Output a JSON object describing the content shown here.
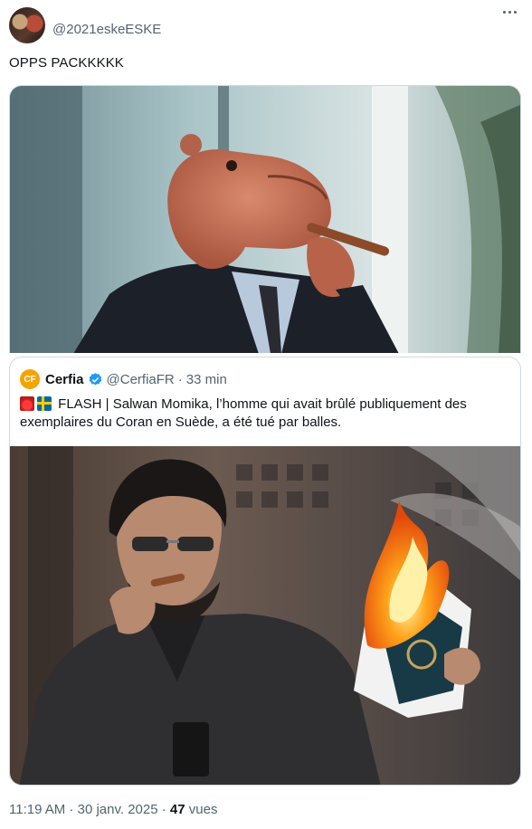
{
  "tweet": {
    "handle": "@2021eskeESKE",
    "text": "OPPS PACKKKKK",
    "time": "11:19 AM",
    "sep1": " · ",
    "date": "30 janv. 2025",
    "sep2": " · ",
    "views_count": "47",
    "views_label": " vues"
  },
  "quote": {
    "name": "Cerfia",
    "handle": "@CerfiaFR",
    "sep": "·",
    "time": "33 min",
    "logo_text": "CF",
    "flag_emojis": [
      "rotating-light-emoji",
      "sweden-flag-emoji"
    ],
    "text": " FLASH | Salwan Momika, l’homme qui avait brûlé publiquement des exemplaires du Coran en Suède, a été tué par balles."
  },
  "icons": [
    "more-icon",
    "verified-badge-icon",
    "cerfia-logo-icon"
  ],
  "colors": {
    "verified": "#1d9bf0",
    "cerfia_brand": "#f5a300",
    "border": "#cfd9de",
    "muted": "#536471"
  }
}
